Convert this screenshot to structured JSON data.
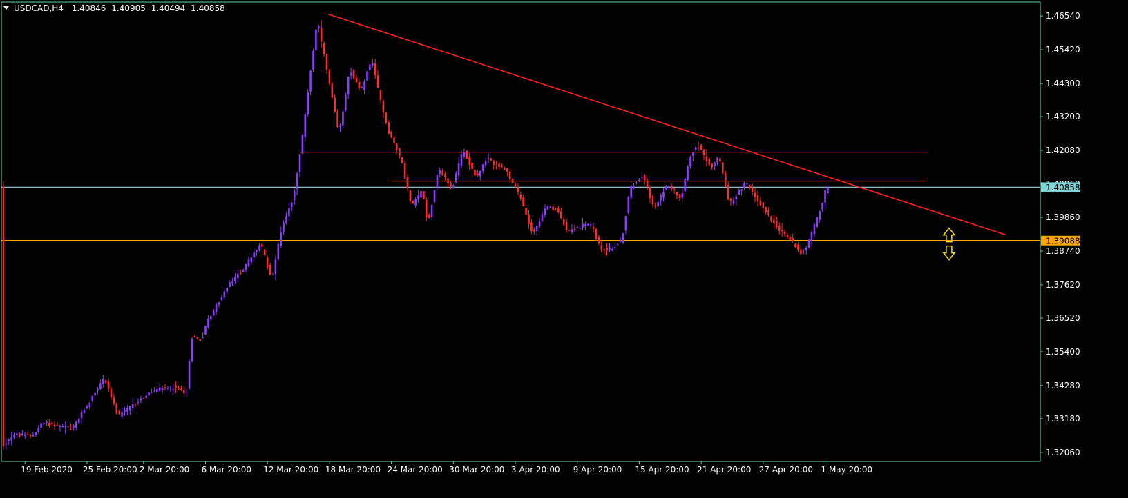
{
  "header": {
    "symbol": "USDCAD,H4",
    "open": "1.40846",
    "high": "1.40905",
    "low": "1.40494",
    "close": "1.40858"
  },
  "colors": {
    "background": "#000000",
    "frame": "#5fd3a0",
    "bull_candle": "#8a3cff",
    "bear_candle": "#ff2a2a",
    "trendline": "#ff2020",
    "resistance_line": "#ff2020",
    "bid_line": "#8fb7c4",
    "support_line": "#ffa500",
    "arrow": "#ffe000",
    "text": "#ffffff"
  },
  "chart_data": {
    "type": "candlestick",
    "title": "USDCAD,H4",
    "ylim": [
      1.3176,
      1.47
    ],
    "x_range": [
      0,
      320
    ],
    "y_ticks": [
      "1.46540",
      "1.45420",
      "1.44300",
      "1.43200",
      "1.42080",
      "1.40960",
      "1.39860",
      "1.38740",
      "1.37620",
      "1.36520",
      "1.35400",
      "1.34280",
      "1.33180",
      "1.32060"
    ],
    "x_ticks": [
      {
        "label": "19 Feb 2020",
        "index": 8
      },
      {
        "label": "25 Feb 20:00",
        "index": 31
      },
      {
        "label": "2 Mar 20:00",
        "index": 52
      },
      {
        "label": "6 Mar 20:00",
        "index": 75
      },
      {
        "label": "12 Mar 20:00",
        "index": 98
      },
      {
        "label": "18 Mar 20:00",
        "index": 121
      },
      {
        "label": "24 Mar 20:00",
        "index": 144
      },
      {
        "label": "30 Mar 20:00",
        "index": 167
      },
      {
        "label": "3 Apr 20:00",
        "index": 190
      },
      {
        "label": "9 Apr 20:00",
        "index": 213
      },
      {
        "label": "15 Apr 20:00",
        "index": 236
      },
      {
        "label": "21 Apr 20:00",
        "index": 259
      },
      {
        "label": "27 Apr 20:00",
        "index": 282
      },
      {
        "label": "1 May 20:00",
        "index": 305
      }
    ],
    "anchors": [
      {
        "i": 0,
        "p": 1.3225
      },
      {
        "i": 4,
        "p": 1.3265
      },
      {
        "i": 11,
        "p": 1.326
      },
      {
        "i": 15,
        "p": 1.3305
      },
      {
        "i": 26,
        "p": 1.3285
      },
      {
        "i": 30,
        "p": 1.334
      },
      {
        "i": 38,
        "p": 1.3455
      },
      {
        "i": 43,
        "p": 1.3325
      },
      {
        "i": 51,
        "p": 1.338
      },
      {
        "i": 57,
        "p": 1.3415
      },
      {
        "i": 64,
        "p": 1.342
      },
      {
        "i": 68,
        "p": 1.3405
      },
      {
        "i": 69,
        "p": 1.342
      },
      {
        "i": 70,
        "p": 1.359
      },
      {
        "i": 74,
        "p": 1.358
      },
      {
        "i": 76,
        "p": 1.364
      },
      {
        "i": 84,
        "p": 1.376
      },
      {
        "i": 90,
        "p": 1.382
      },
      {
        "i": 96,
        "p": 1.39
      },
      {
        "i": 100,
        "p": 1.378
      },
      {
        "i": 104,
        "p": 1.396
      },
      {
        "i": 108,
        "p": 1.405
      },
      {
        "i": 111,
        "p": 1.422
      },
      {
        "i": 114,
        "p": 1.444
      },
      {
        "i": 117,
        "p": 1.464
      },
      {
        "i": 121,
        "p": 1.445
      },
      {
        "i": 125,
        "p": 1.426
      },
      {
        "i": 129,
        "p": 1.448
      },
      {
        "i": 133,
        "p": 1.44
      },
      {
        "i": 137,
        "p": 1.451
      },
      {
        "i": 143,
        "p": 1.428
      },
      {
        "i": 148,
        "p": 1.418
      },
      {
        "i": 152,
        "p": 1.402
      },
      {
        "i": 156,
        "p": 1.408
      },
      {
        "i": 158,
        "p": 1.396
      },
      {
        "i": 162,
        "p": 1.415
      },
      {
        "i": 167,
        "p": 1.408
      },
      {
        "i": 171,
        "p": 1.421
      },
      {
        "i": 176,
        "p": 1.412
      },
      {
        "i": 180,
        "p": 1.418
      },
      {
        "i": 187,
        "p": 1.414
      },
      {
        "i": 192,
        "p": 1.406
      },
      {
        "i": 197,
        "p": 1.393
      },
      {
        "i": 202,
        "p": 1.402
      },
      {
        "i": 206,
        "p": 1.401
      },
      {
        "i": 210,
        "p": 1.394
      },
      {
        "i": 216,
        "p": 1.396
      },
      {
        "i": 219,
        "p": 1.396
      },
      {
        "i": 222,
        "p": 1.388
      },
      {
        "i": 226,
        "p": 1.388
      },
      {
        "i": 230,
        "p": 1.391
      },
      {
        "i": 233,
        "p": 1.408
      },
      {
        "i": 238,
        "p": 1.413
      },
      {
        "i": 242,
        "p": 1.401
      },
      {
        "i": 247,
        "p": 1.41
      },
      {
        "i": 252,
        "p": 1.405
      },
      {
        "i": 255,
        "p": 1.418
      },
      {
        "i": 258,
        "p": 1.423
      },
      {
        "i": 263,
        "p": 1.415
      },
      {
        "i": 266,
        "p": 1.419
      },
      {
        "i": 270,
        "p": 1.403
      },
      {
        "i": 276,
        "p": 1.41
      },
      {
        "i": 283,
        "p": 1.401
      },
      {
        "i": 289,
        "p": 1.394
      },
      {
        "i": 294,
        "p": 1.39
      },
      {
        "i": 297,
        "p": 1.386
      },
      {
        "i": 300,
        "p": 1.392
      },
      {
        "i": 304,
        "p": 1.402
      },
      {
        "i": 306,
        "p": 1.4086
      }
    ],
    "lines": [
      {
        "name": "trendline",
        "kind": "trend",
        "x1": 120.5,
        "y1": 1.466,
        "x2": 372,
        "y2": 1.3928,
        "color": "#ff2020"
      },
      {
        "name": "resistance-upper",
        "kind": "horizontal",
        "x1": 110,
        "x2": 343,
        "y": 1.4202,
        "color": "#ff2020"
      },
      {
        "name": "resistance-lower",
        "kind": "horizontal",
        "x1": 144,
        "x2": 342,
        "y": 1.4106,
        "color": "#ff2020"
      },
      {
        "name": "support",
        "kind": "horizontal",
        "x1": 0,
        "x2": 385,
        "y": 1.39088,
        "color": "#ffa500"
      },
      {
        "name": "bid",
        "kind": "horizontal",
        "x1": 0,
        "x2": 385,
        "y": 1.40858,
        "color": "#8fb7c4"
      }
    ],
    "price_tags": [
      {
        "label": "1.40858",
        "price": 1.40858,
        "bg": "#7fd6d6"
      },
      {
        "label": "1.39088",
        "price": 1.39088,
        "bg": "#ffa500"
      }
    ],
    "arrow_marker": {
      "index": 351,
      "price": 1.39,
      "color": "#ffe000"
    }
  }
}
